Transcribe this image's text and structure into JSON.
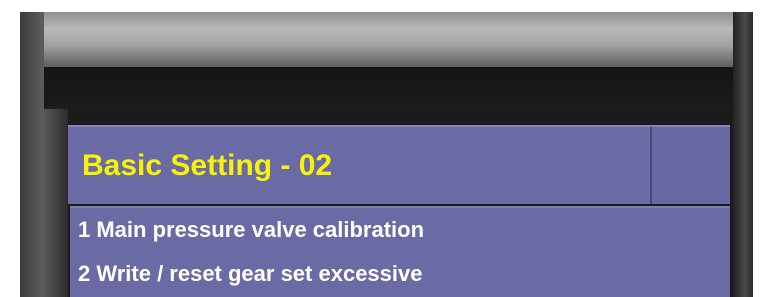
{
  "title": "Basic Setting - 02",
  "menu": {
    "items": [
      {
        "label": "1 Main pressure valve calibration"
      },
      {
        "label": "2 Write / reset gear set excessive"
      }
    ]
  },
  "colors": {
    "title_text": "#f6f20a",
    "panel_bg": "#6a6aa4",
    "menu_text": "#ffffff",
    "screen_bg": "#1b1b1c"
  }
}
